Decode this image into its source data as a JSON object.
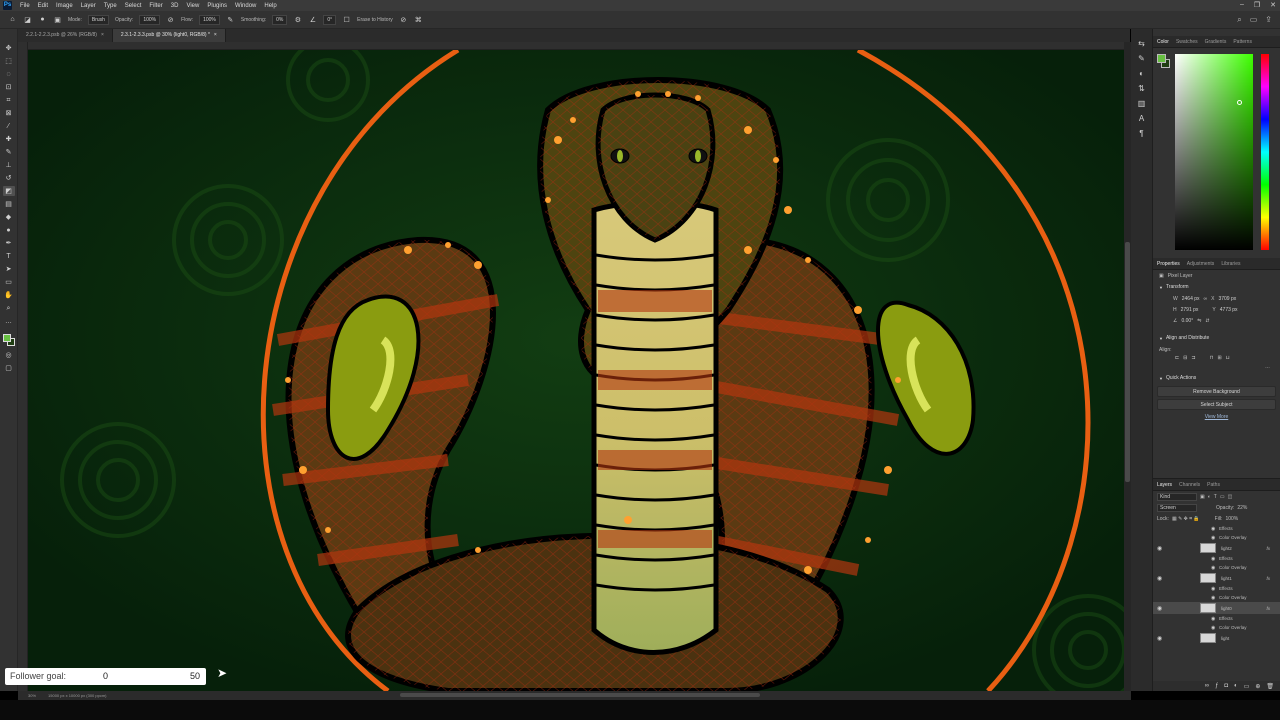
{
  "menubar": {
    "items": [
      "File",
      "Edit",
      "Image",
      "Layer",
      "Type",
      "Select",
      "Filter",
      "3D",
      "View",
      "Plugins",
      "Window",
      "Help"
    ],
    "logo": "Ps"
  },
  "options_bar": {
    "mode_label": "Mode:",
    "mode_value": "Brush",
    "opacity_label": "Opacity:",
    "opacity_value": "100%",
    "flow_label": "Flow:",
    "flow_value": "100%",
    "smoothing_label": "Smoothing:",
    "smoothing_value": "0%",
    "angle_value": "0°",
    "erase_to_history": "Erase to History"
  },
  "tabs": [
    {
      "label": "2.2.1-2.2.3.psb @ 26% (RGB/8)",
      "close": "×"
    },
    {
      "label": "2.3.1-2.3.3.psb @ 30% (light0, RGB/8) *",
      "close": "×"
    }
  ],
  "status_bar": {
    "zoom": "30%",
    "doc_size": "15000 px x 10000 px (300 ppcm)"
  },
  "follower_goal": {
    "label": "Follower goal:",
    "current": "0",
    "target": "50"
  },
  "color_panel": {
    "tabs": [
      "Color",
      "Swatches",
      "Gradients",
      "Patterns"
    ],
    "foreground": "#68c042",
    "background": "#1f3d12"
  },
  "properties_panel": {
    "tabs": [
      "Properties",
      "Adjustments",
      "Libraries"
    ],
    "layer_type": "Pixel Layer",
    "transform_title": "Transform",
    "w_label": "W",
    "w_value": "2464 px",
    "h_label": "H",
    "h_value": "2791 px",
    "x_label": "X",
    "x_value": "3709 px",
    "y_label": "Y",
    "y_value": "4773 px",
    "angle_value": "0.00°",
    "align_title": "Align and Distribute",
    "align_label": "Align:",
    "quick_actions_title": "Quick Actions",
    "remove_bg": "Remove Background",
    "select_subject": "Select Subject",
    "view_more": "View More"
  },
  "layers_panel": {
    "tabs": [
      "Layers",
      "Channels",
      "Paths"
    ],
    "search_placeholder": "Kind",
    "blend_mode": "Screen",
    "opacity_label": "Opacity:",
    "opacity_value": "22%",
    "lock_label": "Lock:",
    "fill_label": "Fill:",
    "fill_value": "100%",
    "rows": [
      {
        "kind": "effect",
        "name": "Effects"
      },
      {
        "kind": "effect",
        "name": "Color Overlay"
      },
      {
        "kind": "layer",
        "name": "light2",
        "fx": "fx"
      },
      {
        "kind": "effect",
        "name": "Effects"
      },
      {
        "kind": "effect",
        "name": "Color Overlay"
      },
      {
        "kind": "layer",
        "name": "light1",
        "fx": "fx"
      },
      {
        "kind": "effect",
        "name": "Effects"
      },
      {
        "kind": "effect",
        "name": "Color Overlay"
      },
      {
        "kind": "layer",
        "name": "light0",
        "fx": "fx",
        "selected": true
      },
      {
        "kind": "effect",
        "name": "Effects"
      },
      {
        "kind": "effect",
        "name": "Color Overlay"
      },
      {
        "kind": "layer",
        "name": "light",
        "fx": ""
      }
    ]
  },
  "icons": {
    "toolbar": [
      "move-icon",
      "marquee-icon",
      "lasso-icon",
      "object-select-icon",
      "crop-icon",
      "frame-icon",
      "eyedropper-icon",
      "healing-icon",
      "brush-icon",
      "stamp-icon",
      "history-brush-icon",
      "eraser-icon",
      "gradient-icon",
      "blur-icon",
      "dodge-icon",
      "pen-icon",
      "type-icon",
      "path-select-icon",
      "rectangle-icon",
      "hand-icon",
      "zoom-icon",
      "more-icon"
    ]
  }
}
